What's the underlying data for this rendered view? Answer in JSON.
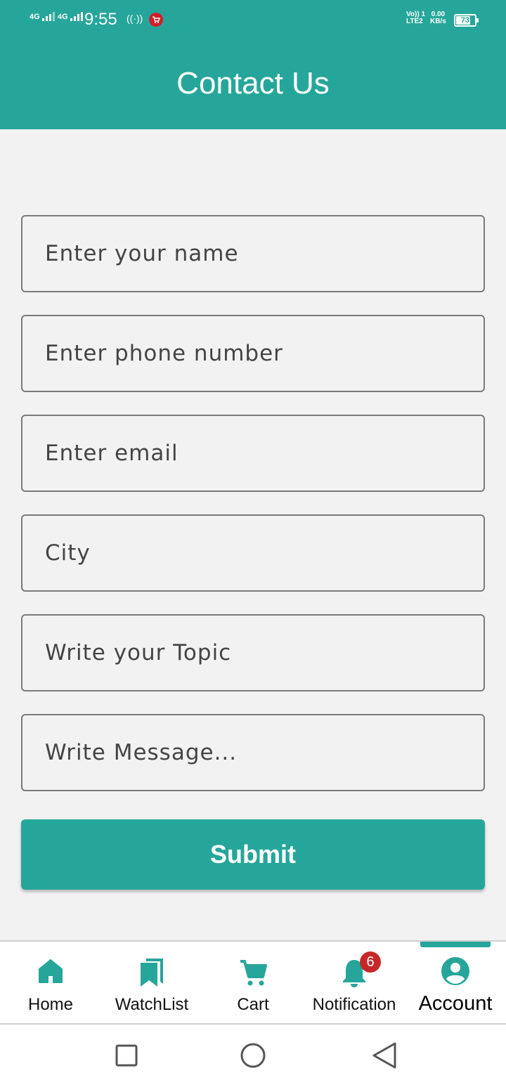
{
  "status_bar": {
    "net1": "4G",
    "net2": "4G",
    "time": "9:55",
    "hotspot": "((·))",
    "volte_top": "Vo)) 1",
    "volte_bottom": "LTE2",
    "speed_top": "0.00",
    "speed_bottom": "KB/s",
    "battery": "73",
    "battery_level": 0.73
  },
  "header": {
    "title": "Contact Us"
  },
  "form": {
    "name_placeholder": "Enter your name",
    "phone_placeholder": "Enter phone number",
    "email_placeholder": "Enter email",
    "city_placeholder": "City",
    "topic_placeholder": "Write your Topic",
    "message_placeholder": "Write Message...",
    "submit_label": "Submit"
  },
  "bottom_nav": {
    "items": [
      {
        "label": "Home",
        "icon": "home-icon"
      },
      {
        "label": "WatchList",
        "icon": "bookmarks-icon"
      },
      {
        "label": "Cart",
        "icon": "cart-icon"
      },
      {
        "label": "Notification",
        "icon": "bell-icon",
        "badge": "6"
      },
      {
        "label": "Account",
        "icon": "account-icon",
        "active": true
      }
    ]
  },
  "colors": {
    "accent": "#26a69a",
    "badge": "#c62828",
    "background": "#f2f2f2"
  }
}
